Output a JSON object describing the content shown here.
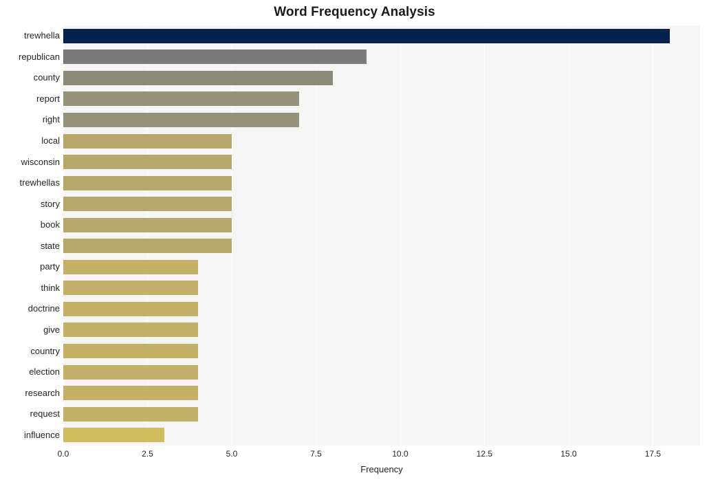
{
  "chart_data": {
    "type": "bar",
    "orientation": "horizontal",
    "title": "Word Frequency Analysis",
    "xlabel": "Frequency",
    "ylabel": "",
    "categories": [
      "trewhella",
      "republican",
      "county",
      "report",
      "right",
      "local",
      "wisconsin",
      "trewhellas",
      "story",
      "book",
      "state",
      "party",
      "think",
      "doctrine",
      "give",
      "country",
      "election",
      "research",
      "request",
      "influence"
    ],
    "values": [
      18,
      9,
      8,
      7,
      7,
      5,
      5,
      5,
      5,
      5,
      5,
      4,
      4,
      4,
      4,
      4,
      4,
      4,
      4,
      3
    ],
    "xlim": [
      0,
      18.9
    ],
    "xticks": [
      0.0,
      2.5,
      5.0,
      7.5,
      10.0,
      12.5,
      15.0,
      17.5
    ],
    "xtick_labels": [
      "0.0",
      "2.5",
      "5.0",
      "7.5",
      "10.0",
      "12.5",
      "15.0",
      "17.5"
    ],
    "grid": true,
    "grid_axis": "x",
    "legend": false,
    "bar_colors": [
      "#04244f",
      "#7b7a78",
      "#8a8878",
      "#95917c",
      "#95917c",
      "#b5a868",
      "#b5a868",
      "#b5a868",
      "#b5a868",
      "#b5a868",
      "#b5a868",
      "#c2b166",
      "#c2b166",
      "#c2b166",
      "#c2b166",
      "#c2b166",
      "#c2b166",
      "#c2b166",
      "#c2b166",
      "#d0bd5c"
    ],
    "plot_background": "#f5f5f5",
    "figure_background": "#ffffff"
  }
}
